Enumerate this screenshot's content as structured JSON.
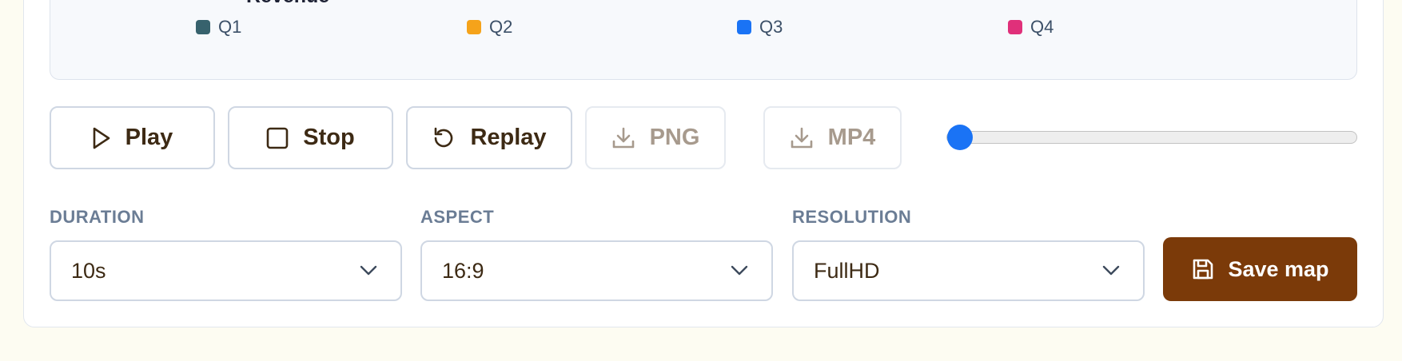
{
  "chart": {
    "title": "Revenue",
    "legend": [
      {
        "label": "Q1",
        "color": "#37626d"
      },
      {
        "label": "Q2",
        "color": "#f5a31a"
      },
      {
        "label": "Q3",
        "color": "#1a73f5"
      },
      {
        "label": "Q4",
        "color": "#e0307a"
      }
    ]
  },
  "controls": {
    "play_label": "Play",
    "stop_label": "Stop",
    "replay_label": "Replay",
    "png_label": "PNG",
    "mp4_label": "MP4",
    "progress": 0
  },
  "settings": {
    "duration": {
      "label": "DURATION",
      "value": "10s"
    },
    "aspect": {
      "label": "ASPECT",
      "value": "16:9"
    },
    "resolution": {
      "label": "RESOLUTION",
      "value": "FullHD"
    },
    "save_label": "Save map"
  },
  "icons": [
    "play-icon",
    "stop-icon",
    "replay-icon",
    "download-icon",
    "chevron-down-icon",
    "save-icon"
  ],
  "colors": {
    "accent": "#7b3a09",
    "slider": "#1a73f5",
    "background": "#fdfcf2"
  }
}
